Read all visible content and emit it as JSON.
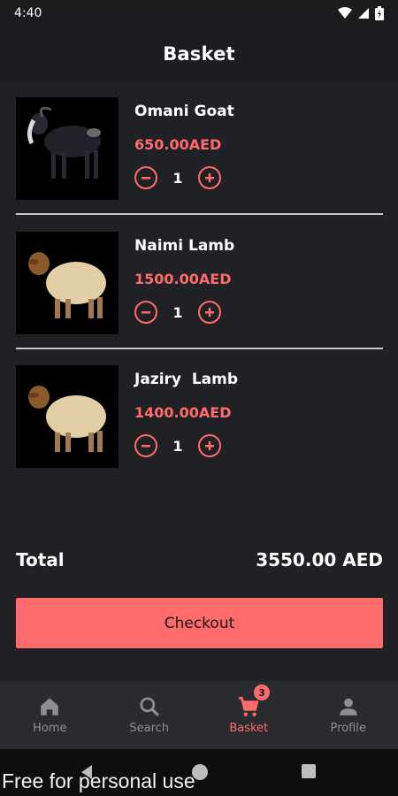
{
  "status": {
    "time": "4:40"
  },
  "header": {
    "title": "Basket"
  },
  "items": [
    {
      "name": "Omani Goat",
      "price": "650.00AED",
      "quantity": "1",
      "image": "black goat"
    },
    {
      "name": "Naimi Lamb",
      "price": "1500.00AED",
      "quantity": "1",
      "image": "cream lamb"
    },
    {
      "name": "Jaziry  Lamb",
      "price": "1400.00AED",
      "quantity": "1",
      "image": "cream lamb"
    }
  ],
  "total": {
    "label": "Total",
    "value": "3550.00 AED"
  },
  "checkout": {
    "label": "Checkout"
  },
  "nav": {
    "home": "Home",
    "search": "Search",
    "basket": "Basket",
    "basket_badge": "3",
    "profile": "Profile"
  },
  "watermark": "Free for personal use",
  "colors": {
    "accent": "#ff6b6b",
    "background": "#202124",
    "nav_bg": "#2a2b2e"
  }
}
